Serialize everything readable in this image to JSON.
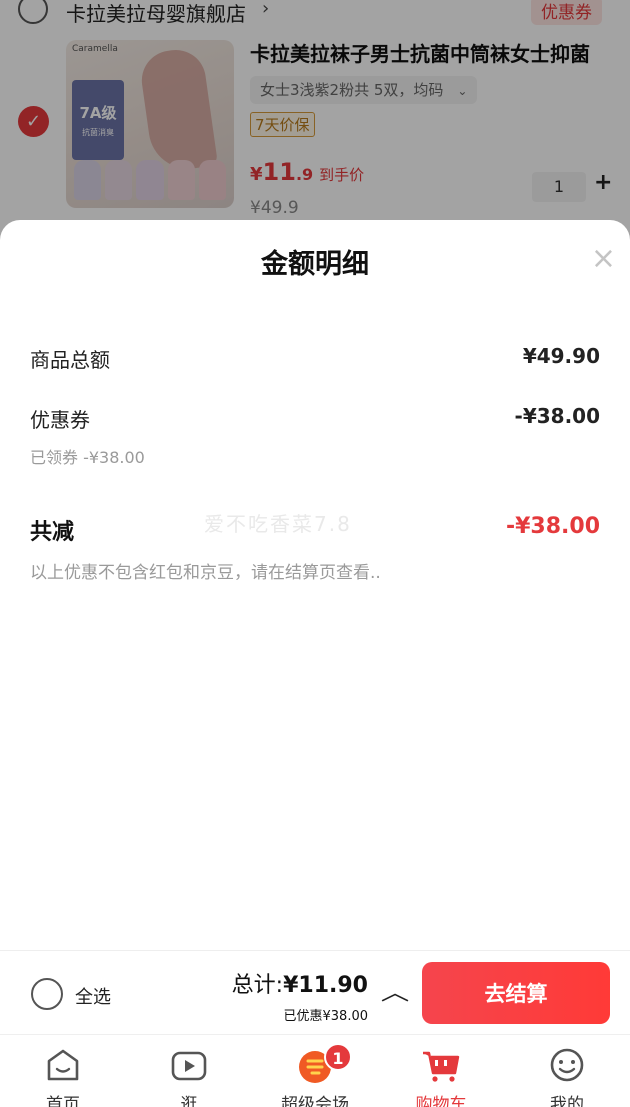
{
  "cart": {
    "store_name": "卡拉美拉母婴旗舰店",
    "coupon_tag": "优惠券",
    "item": {
      "title": "卡拉美拉袜子男士抗菌中筒袜女士抑菌",
      "spec": "女士3浅紫2粉共 5双，均码",
      "guarantee": "7天价保",
      "price_currency": "¥",
      "price_int": "11",
      "price_dec": ".9",
      "price_label": "到手价",
      "original_price": "¥49.9",
      "quantity": "1",
      "thumb_brand": "Caramella",
      "thumb_badge_main": "7A级",
      "thumb_badge_sub": "抗菌消臭"
    }
  },
  "sheet": {
    "title": "金额明细",
    "close_icon": "×",
    "goods_total_label": "商品总额",
    "goods_total_value": "¥49.90",
    "coupon_label": "优惠券",
    "coupon_value": "-¥38.00",
    "coupon_sub": "已领券 -¥38.00",
    "total_discount_label": "共减",
    "total_discount_value": "-¥38.00",
    "note": "以上优惠不包含红包和京豆，请在结算页查看..",
    "watermark": "爱不吃香菜7.8"
  },
  "checkout": {
    "select_all_label": "全选",
    "total_prefix": "总计:",
    "total_amount": "¥11.90",
    "saved": "已优惠¥38.00",
    "button_label": "去结算"
  },
  "tabbar": {
    "tabs": [
      {
        "label": "首页",
        "icon": "home-icon"
      },
      {
        "label": "逛",
        "icon": "video-icon"
      },
      {
        "label": "超级会场",
        "icon": "super-venue-icon",
        "badge": "1"
      },
      {
        "label": "购物车",
        "icon": "cart-icon",
        "active": true
      },
      {
        "label": "我的",
        "icon": "profile-icon"
      }
    ]
  },
  "colors": {
    "accent": "#e4393c",
    "checkout_button": "#f5454d"
  }
}
